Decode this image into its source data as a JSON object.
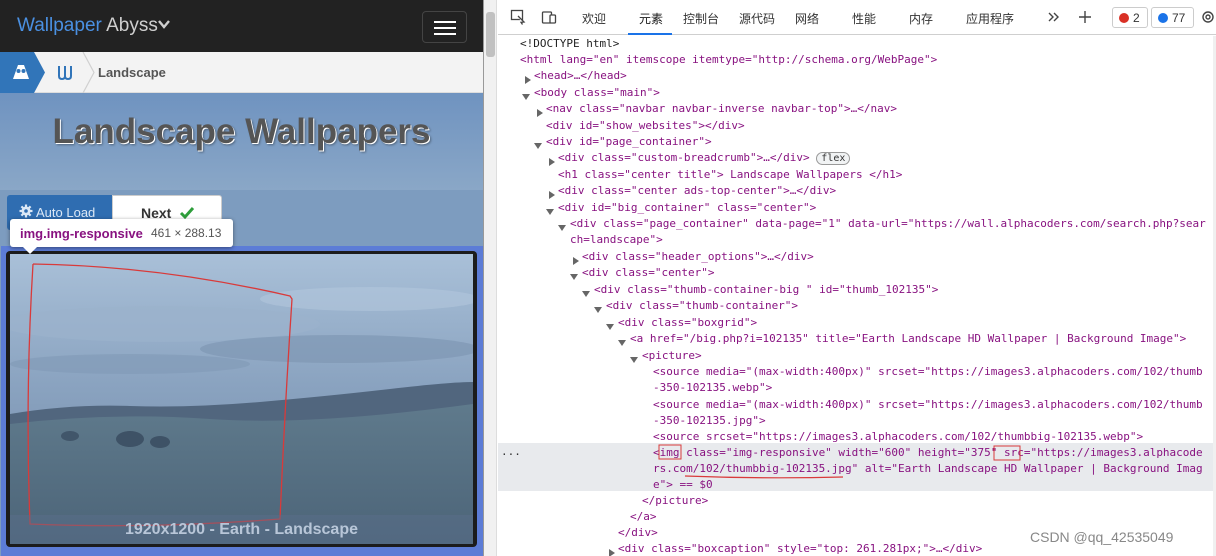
{
  "site": {
    "brand_blue": "Wallpaper",
    "brand_gray": " Abyss",
    "breadcrumb": "Landscape",
    "title": "Landscape Wallpapers",
    "auto_load": "Auto Load",
    "next": "Next",
    "tooltip_name": "img.img-responsive",
    "tooltip_dims": "461 × 288.13",
    "caption": "1920x1200 -  Earth -  Landscape"
  },
  "devtools": {
    "tabs": [
      "欢迎",
      "元素",
      "控制台",
      "源代码",
      "网络",
      "性能",
      "内存",
      "应用程序"
    ],
    "active_tab": "元素",
    "errors": "2",
    "messages": "77",
    "dom_lines": [
      "<!DOCTYPE html>",
      "<html lang=\"en\" itemscope itemtype=\"http://schema.org/WebPage\">",
      "<head>…</head>",
      "<body class=\"main\">",
      "<nav class=\"navbar navbar-inverse navbar-top\">…</nav>",
      "<div id=\"show_websites\"></div>",
      "<div id=\"page_container\">",
      "<div class=\"custom-breadcrumb\">…</div>",
      "<h1 class=\"center title\"> Landscape Wallpapers </h1>",
      "<div class=\"center ads-top-center\">…</div>",
      "<div id=\"big_container\" class=\"center\">",
      "<div class=\"page_container\" data-page=\"1\" data-url=\"https://wall.alphacoders.com/search.php?sear",
      "ch=landscape\">",
      "<div class=\"header_options\">…</div>",
      "<div class=\"center\">",
      "<div class=\"thumb-container-big \" id=\"thumb_102135\">",
      "<div class=\"thumb-container\">",
      "<div class=\"boxgrid\">",
      "<a href=\"/big.php?i=102135\" title=\"Earth Landscape HD Wallpaper | Background Image\">",
      "<picture>",
      "<source media=\"(max-width:400px)\" srcset=\"https://images3.alphacoders.com/102/thumb",
      "-350-102135.webp\">",
      "<source media=\"(max-width:400px)\" srcset=\"https://images3.alphacoders.com/102/thumb",
      "-350-102135.jpg\">",
      "<source srcset=\"https://images3.alphacoders.com/102/thumbbig-102135.webp\">",
      "<img class=\"img-responsive\" width=\"600\" height=\"375\" src=\"https://images3.alphacode",
      "rs.com/102/thumbbig-102135.jpg\" alt=\"Earth Landscape HD Wallpaper | Background Imag",
      "e\"> == $0",
      "</picture>",
      "</a>",
      "</div>",
      "<div class=\"boxcaption\" style=\"top: 261.281px;\">…</div>"
    ],
    "flex_badge": "flex",
    "selected_marker": "...",
    "watermark": "CSDN @qq_42535049"
  }
}
